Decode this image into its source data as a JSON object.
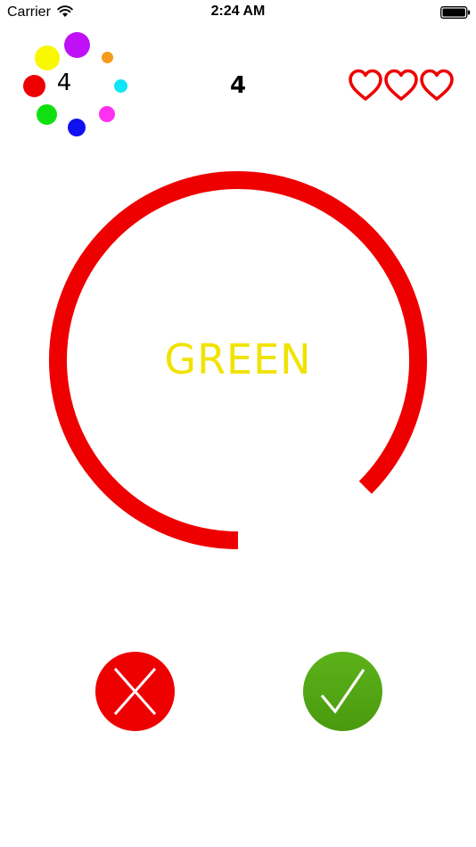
{
  "status_bar": {
    "carrier": "Carrier",
    "time": "2:24 AM"
  },
  "game": {
    "color_wheel_count": "4",
    "score": "4",
    "lives": 3,
    "timer_remaining_fraction": 0.875,
    "word": "GREEN",
    "word_color": "#f0e300",
    "ring_color": "#ee0000"
  },
  "color_wheel": [
    {
      "name": "purple",
      "color": "#c010f8"
    },
    {
      "name": "orange",
      "color": "#f59a1a"
    },
    {
      "name": "cyan",
      "color": "#10e6f5"
    },
    {
      "name": "magenta",
      "color": "#ff30f0"
    },
    {
      "name": "blue",
      "color": "#1010f0"
    },
    {
      "name": "green",
      "color": "#10e010"
    },
    {
      "name": "red",
      "color": "#ee0000"
    },
    {
      "name": "yellow",
      "color": "#f8f800"
    }
  ],
  "buttons": {
    "no_icon": "cross-icon",
    "yes_icon": "check-icon",
    "no_color": "#ee0000",
    "yes_color": "#55a812"
  }
}
